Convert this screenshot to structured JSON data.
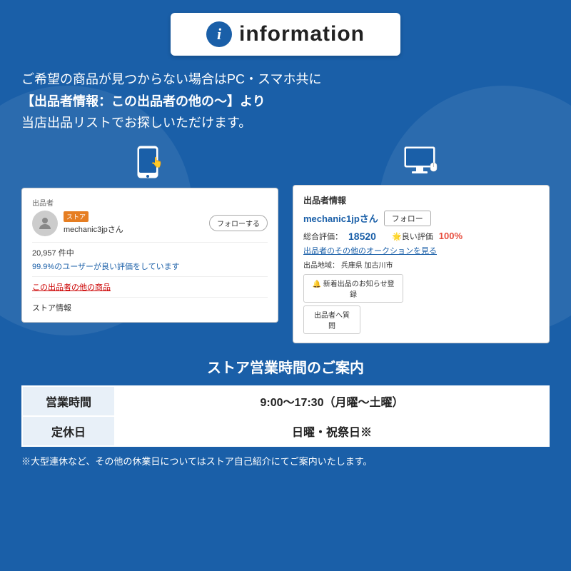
{
  "header": {
    "icon_letter": "i",
    "title": "information"
  },
  "main_text": {
    "line1": "ご希望の商品が見つからない場合はPC・スマホ共に",
    "line2": "【出品者情報：この出品者の他の〜】より",
    "line3": "当店出品リストでお探しいただけます。"
  },
  "mobile_card": {
    "section_label": "出品者",
    "store_badge": "ストア",
    "seller_name": "mechanic3jpさん",
    "follow_button": "フォローする",
    "rating_count": "20,957 件中",
    "rating_percent": "99.9%のユーザーが良い評価をしています",
    "other_items_link": "この出品者の他の商品",
    "store_info_link": "ストア情報"
  },
  "pc_card": {
    "section_title": "出品者情報",
    "seller_name": "mechanic1jpさん",
    "follow_button": "フォロー",
    "total_rating_label": "総合評価：",
    "total_rating_value": "18520",
    "good_label": "🌟良い評価",
    "good_value": "100%",
    "auction_link": "出品者のその他のオークションを見る",
    "location_label": "出品地域：",
    "location_value": "兵庫県 加古川市",
    "notify_button": "🔔 新着出品のお知らせ登録",
    "question_button": "出品者へ質問"
  },
  "store_hours": {
    "title": "ストア営業時間のご案内",
    "rows": [
      {
        "label": "営業時間",
        "value": "9:00〜17:30（月曜〜土曜）"
      },
      {
        "label": "定休日",
        "value": "日曜・祝祭日※"
      }
    ],
    "note": "※大型連休など、その他の休業日についてはストア自己紹介にてご案内いたします。"
  },
  "device_icons": {
    "mobile": "📱",
    "desktop": "🖥️"
  }
}
